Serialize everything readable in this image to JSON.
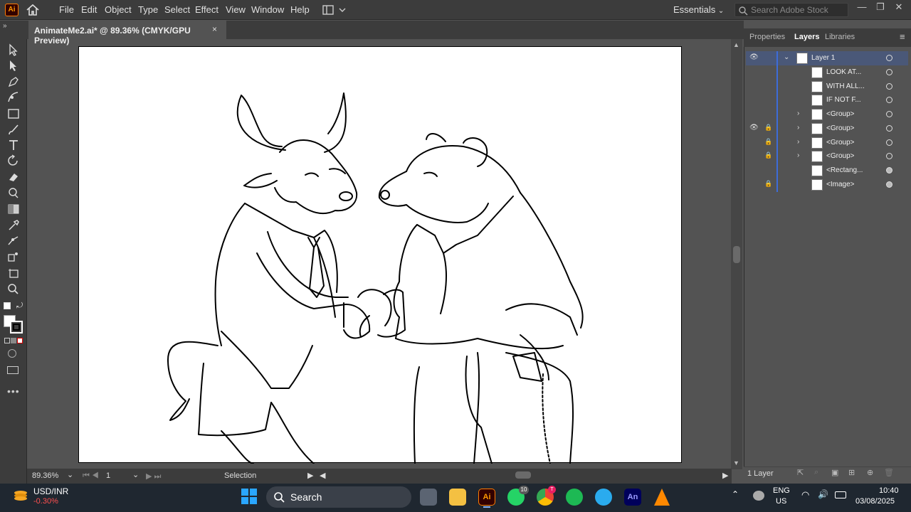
{
  "app": {
    "logo": "Ai"
  },
  "menu": [
    "File",
    "Edit",
    "Object",
    "Type",
    "Select",
    "Effect",
    "View",
    "Window",
    "Help"
  ],
  "workspace": {
    "label": "Essentials",
    "search_placeholder": "Search Adobe Stock"
  },
  "document_tab": {
    "title": "AnimateMe2.ai* @ 89.36% (CMYK/GPU Preview)",
    "close": "×"
  },
  "status": {
    "zoom": "89.36%",
    "artboard": "1",
    "tool": "Selection"
  },
  "panel": {
    "tabs": [
      "Properties",
      "Layers",
      "Libraries"
    ],
    "active_tab": "Layers",
    "layers": [
      {
        "name": "Layer 1",
        "visible": true,
        "locked": false,
        "expandable": true,
        "target": "open"
      },
      {
        "name": "LOOK AT...",
        "visible": false,
        "locked": false,
        "expandable": false,
        "target": "open"
      },
      {
        "name": "WITH ALL...",
        "visible": false,
        "locked": false,
        "expandable": false,
        "target": "open"
      },
      {
        "name": "IF NOT F...",
        "visible": false,
        "locked": false,
        "expandable": false,
        "target": "open"
      },
      {
        "name": "<Group>",
        "visible": false,
        "locked": false,
        "expandable": true,
        "target": "open"
      },
      {
        "name": "<Group>",
        "visible": true,
        "locked": true,
        "expandable": true,
        "target": "open"
      },
      {
        "name": "<Group>",
        "visible": false,
        "locked": true,
        "expandable": true,
        "target": "open"
      },
      {
        "name": "<Group>",
        "visible": false,
        "locked": true,
        "expandable": true,
        "target": "open"
      },
      {
        "name": "<Rectang...",
        "visible": false,
        "locked": false,
        "expandable": false,
        "target": "filled"
      },
      {
        "name": "<Image>",
        "visible": false,
        "locked": true,
        "expandable": false,
        "target": "filled"
      }
    ],
    "footer": {
      "layer_count": "1 Layer"
    }
  },
  "taskbar": {
    "ticker": {
      "symbol": "USD/INR",
      "change": "-0.30%"
    },
    "search_label": "Search",
    "badges": {
      "whatsapp": "10",
      "chrome": "T"
    },
    "lang": {
      "line1": "ENG",
      "line2": "US"
    },
    "time": "10:40",
    "date": "03/08/2025"
  },
  "colors": {
    "accent": "#3d6cd9",
    "ai_orange": "#ff9a00",
    "ticker_negative": "#ff5050"
  }
}
